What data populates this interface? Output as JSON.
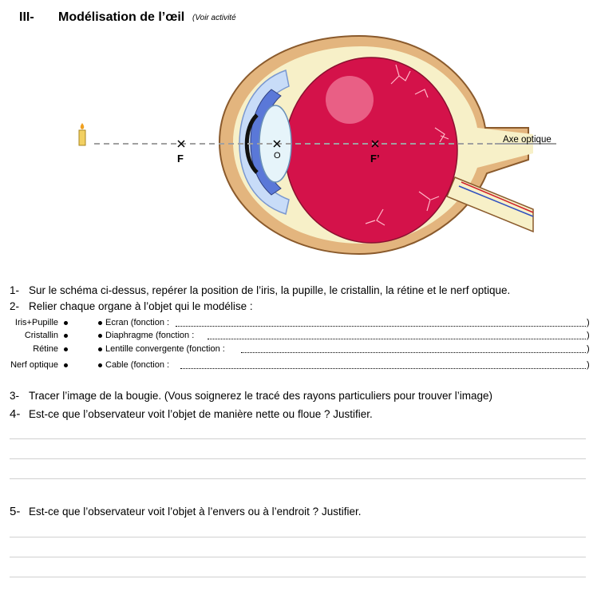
{
  "header": {
    "number": "III-",
    "title": "Modélisation de l’œil",
    "note": "(Voir activité"
  },
  "diagram": {
    "axis_label": "Axe optique",
    "point_f": "F",
    "point_o": "O",
    "point_f_prime": "F’"
  },
  "questions": {
    "q1": {
      "num": "1-",
      "text": "Sur le schéma ci-dessus, repérer la position de l’iris, la pupille, le cristallin, la rétine et le nerf optique."
    },
    "q2": {
      "num": "2-",
      "text": "Relier chaque organe à l’objet qui le modélise :"
    },
    "q3": {
      "num": "3-",
      "text": "Tracer l’image de la bougie. (Vous soignerez le tracé des rayons particuliers pour trouver l’image)"
    },
    "q4": {
      "num": "4-",
      "text": "Est-ce que l’observateur voit l’objet de manière nette ou floue ? Justifier."
    },
    "q5": {
      "num": "5-",
      "text": "Est-ce que l’observateur voit l’objet à l’envers ou à l’endroit ? Justifier."
    }
  },
  "matching": {
    "organs": [
      "Iris+Pupille",
      "Cristallin",
      "Rétine",
      "Nerf optique"
    ],
    "objects": [
      "Ecran (fonction :",
      "Diaphragme (fonction :",
      "Lentille convergente (fonction :",
      "Cable (fonction :"
    ],
    "close": ")"
  }
}
